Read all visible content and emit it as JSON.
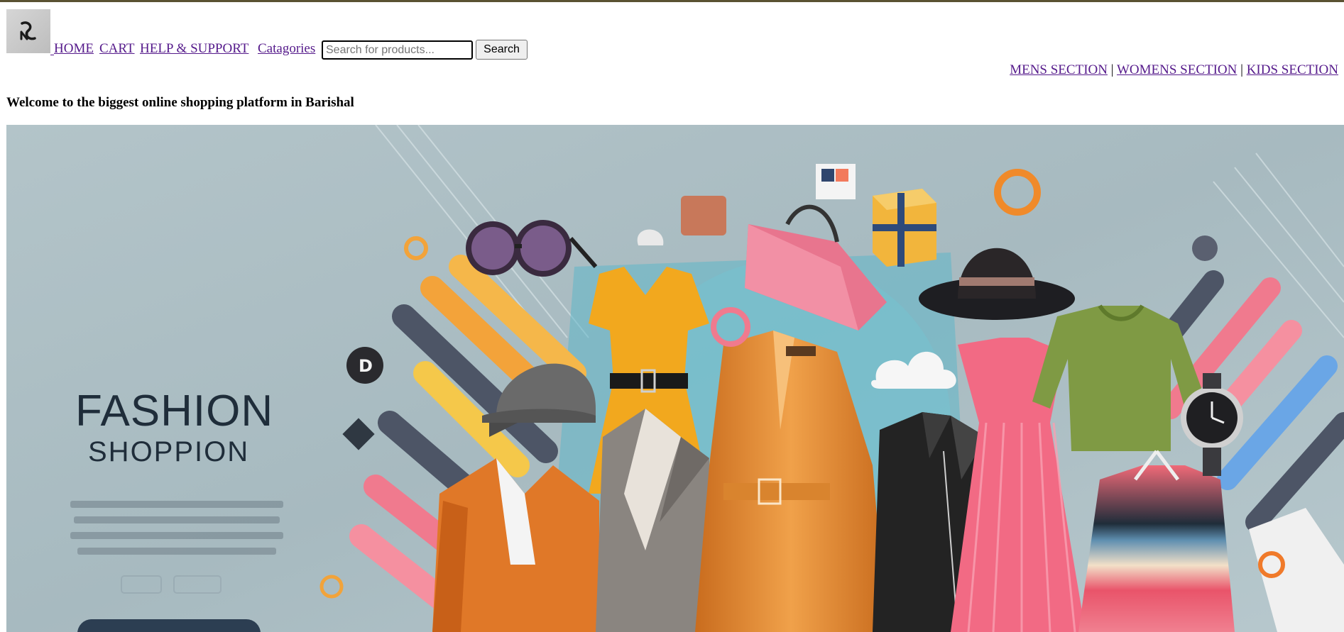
{
  "header": {
    "logo_icon": "store-logo",
    "nav": {
      "home": "HOME",
      "cart": "CART",
      "help": "HELP & SUPPORT",
      "categories": "Catagories"
    },
    "search": {
      "placeholder": "Search for products...",
      "value": "",
      "button_label": "Search"
    }
  },
  "sections": {
    "mens": "MENS SECTION",
    "womens": "WOMENS SECTION",
    "kids": "KIDS SECTION",
    "separator": "|"
  },
  "welcome": "Welcome to the biggest online shopping platform in Barishal",
  "banner": {
    "title": "FASHION",
    "subtitle": "SHOPPION",
    "colors": {
      "background": "#a9bcc2",
      "accent_orange": "#f0a030",
      "accent_pink": "#f07a8e",
      "accent_teal": "#5fc6d6",
      "title_text": "#1f2d3a"
    }
  }
}
